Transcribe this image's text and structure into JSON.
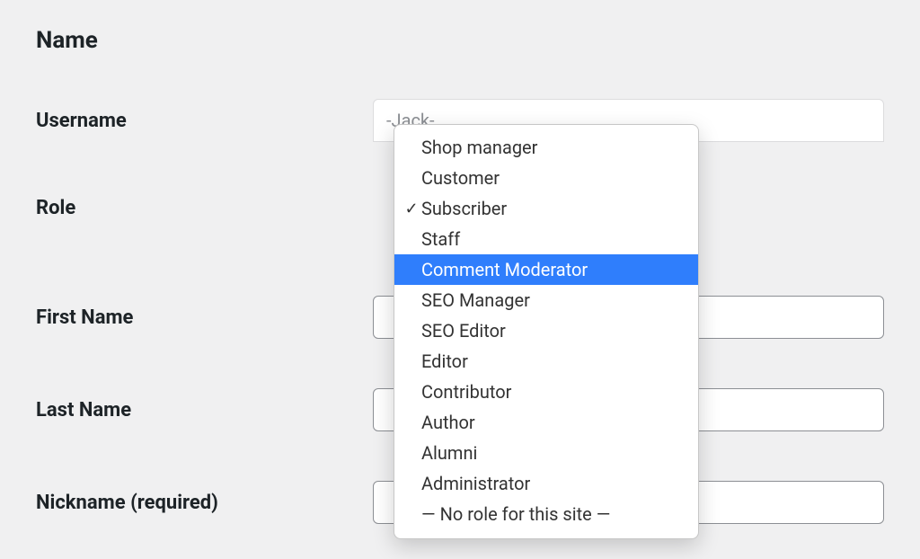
{
  "section": {
    "heading": "Name"
  },
  "fields": {
    "username": {
      "label": "Username",
      "value": "-Jack-"
    },
    "role": {
      "label": "Role",
      "selected": "Subscriber",
      "highlighted": "Comment Moderator",
      "options": [
        "Shop manager",
        "Customer",
        "Subscriber",
        "Staff",
        "Comment Moderator",
        "SEO Manager",
        "SEO Editor",
        "Editor",
        "Contributor",
        "Author",
        "Alumni",
        "Administrator",
        "— No role for this site —"
      ]
    },
    "first_name": {
      "label": "First Name",
      "value": ""
    },
    "last_name": {
      "label": "Last Name",
      "value": ""
    },
    "nickname": {
      "label": "Nickname (required)",
      "value": ""
    }
  }
}
